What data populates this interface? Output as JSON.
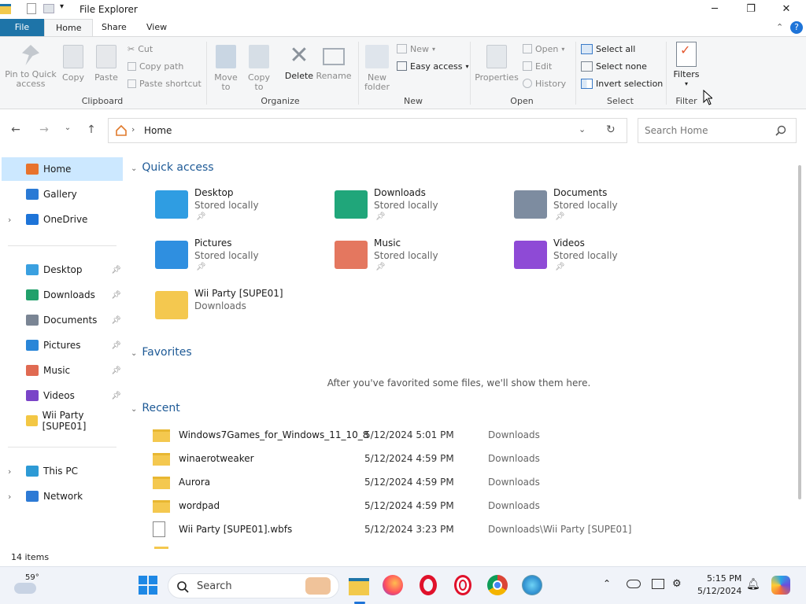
{
  "window": {
    "title": "File Explorer"
  },
  "tabs": {
    "file": "File",
    "home": "Home",
    "share": "Share",
    "view": "View"
  },
  "ribbon": {
    "clipboard": {
      "pin": "Pin to Quick access",
      "copy": "Copy",
      "paste": "Paste",
      "cut": "Cut",
      "copy_path": "Copy path",
      "paste_shortcut": "Paste shortcut",
      "label": "Clipboard"
    },
    "organize": {
      "move_to": "Move to",
      "copy_to": "Copy to",
      "delete": "Delete",
      "rename": "Rename",
      "label": "Organize"
    },
    "new": {
      "new_folder": "New folder",
      "new_item": "New",
      "easy_access": "Easy access",
      "label": "New"
    },
    "open": {
      "properties": "Properties",
      "open": "Open",
      "edit": "Edit",
      "history": "History",
      "label": "Open"
    },
    "select": {
      "select_all": "Select all",
      "select_none": "Select none",
      "invert": "Invert selection",
      "label": "Select"
    },
    "filter": {
      "filters": "Filters",
      "label": "Filter"
    }
  },
  "address": {
    "crumb": "Home",
    "search_placeholder": "Search Home"
  },
  "sidebar": {
    "top": [
      {
        "label": "Home",
        "color": "#e8732c"
      },
      {
        "label": "Gallery",
        "color": "#2a7ad5"
      },
      {
        "label": "OneDrive",
        "color": "#1e74d8"
      }
    ],
    "pinned": [
      {
        "label": "Desktop",
        "color": "#3aa0e0"
      },
      {
        "label": "Downloads",
        "color": "#22a06b"
      },
      {
        "label": "Documents",
        "color": "#7a8594"
      },
      {
        "label": "Pictures",
        "color": "#2a86d8"
      },
      {
        "label": "Music",
        "color": "#e06a52"
      },
      {
        "label": "Videos",
        "color": "#7a44c8"
      },
      {
        "label": "Wii Party [SUPE01]",
        "color": "#f3c744"
      }
    ],
    "bottom": [
      {
        "label": "This PC",
        "color": "#2d9ad5"
      },
      {
        "label": "Network",
        "color": "#2d7ad5"
      }
    ]
  },
  "quick_access": {
    "title": "Quick access",
    "items": [
      {
        "name": "Desktop",
        "sub": "Stored locally",
        "color": "#2f9de2"
      },
      {
        "name": "Downloads",
        "sub": "Stored locally",
        "color": "#20a67a"
      },
      {
        "name": "Documents",
        "sub": "Stored locally",
        "color": "#7d8ca0"
      },
      {
        "name": "Pictures",
        "sub": "Stored locally",
        "color": "#2f8fe0"
      },
      {
        "name": "Music",
        "sub": "Stored locally",
        "color": "#e4775f"
      },
      {
        "name": "Videos",
        "sub": "Stored locally",
        "color": "#8e4ad6"
      },
      {
        "name": "Wii Party [SUPE01]",
        "sub": "Downloads",
        "color": "#f4c84f"
      }
    ]
  },
  "favorites": {
    "title": "Favorites",
    "empty": "After you've favorited some files, we'll show them here."
  },
  "recent": {
    "title": "Recent",
    "rows": [
      {
        "name": "Windows7Games_for_Windows_11_10_8",
        "date": "5/12/2024 5:01 PM",
        "loc": "Downloads"
      },
      {
        "name": "winaerotweaker",
        "date": "5/12/2024 4:59 PM",
        "loc": "Downloads"
      },
      {
        "name": "Aurora",
        "date": "5/12/2024 4:59 PM",
        "loc": "Downloads"
      },
      {
        "name": "wordpad",
        "date": "5/12/2024 4:59 PM",
        "loc": "Downloads"
      },
      {
        "name": "Wii Party [SUPE01].wbfs",
        "date": "5/12/2024 3:23 PM",
        "loc": "Downloads\\Wii Party [SUPE01]"
      }
    ]
  },
  "status": {
    "items": "14 items"
  },
  "taskbar": {
    "weather": "59°",
    "search": "Search",
    "time": "5:15 PM",
    "date": "5/12/2024"
  }
}
